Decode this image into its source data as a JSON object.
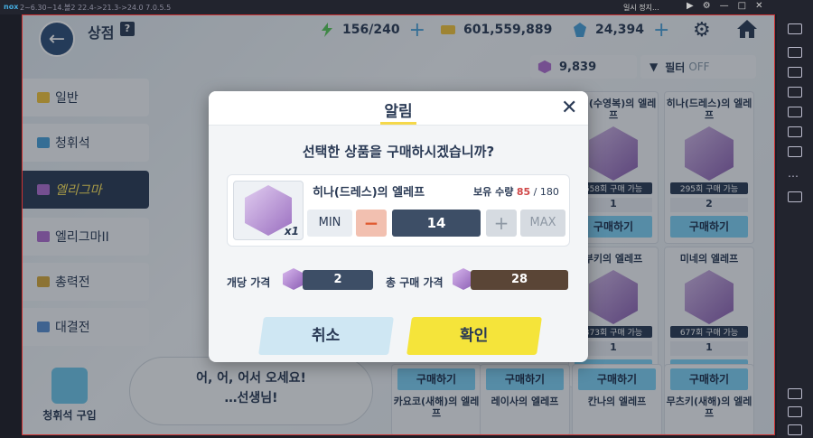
{
  "emulator": {
    "logo": "nox",
    "version_text": "2~6.30~14.볼2 22.4->21.3->24.0 7.0.5.5",
    "pause_text": "일시 정지..."
  },
  "header": {
    "title": "상점",
    "help": "?",
    "stamina": "156/240",
    "credits": "601,559,889",
    "gems": "24,394"
  },
  "sidebar": {
    "items": [
      {
        "label": "일반",
        "icon": "credit-icon",
        "color": "#f2c33a"
      },
      {
        "label": "청휘석",
        "icon": "gem-icon",
        "color": "#4aa0d8"
      },
      {
        "label": "엘리그마",
        "icon": "eligma-icon",
        "color": "#b06fd0",
        "active": true
      },
      {
        "label": "엘리그마II",
        "icon": "eligma-icon",
        "color": "#b06fd0"
      },
      {
        "label": "총력전",
        "icon": "raid-coin-icon",
        "color": "#d6a93c"
      },
      {
        "label": "대결전",
        "icon": "battle-coin-icon",
        "color": "#5a8fd0"
      }
    ]
  },
  "eligma_count": "9,839",
  "filter": {
    "label": "필터",
    "state": "OFF"
  },
  "cards": [
    {
      "title": "이미(수영복)의 엘레프",
      "avail": "658회 구매 가능",
      "qty": "1",
      "buy": "구매하기"
    },
    {
      "title": "히나(드레스)의 엘레프",
      "avail": "295회 구매 가능",
      "qty": "2",
      "buy": "구매하기"
    },
    {
      "title": "부키의 엘레프",
      "avail": "373회 구매 가능",
      "qty": "1",
      "buy": "구매하기"
    },
    {
      "title": "미네의 엘레프",
      "avail": "677회 구매 가능",
      "qty": "1",
      "buy": "구매하기"
    },
    {
      "title": "카요코(새해)의 엘레프",
      "buy": "구매하기"
    },
    {
      "title": "레이사의 엘레프",
      "buy": "구매하기"
    },
    {
      "title": "칸나의 엘레프",
      "buy": "구매하기"
    },
    {
      "title": "무츠키(새해)의 엘레프",
      "buy": "구매하기"
    }
  ],
  "speech": {
    "line1": "어, 어, 어서 오세요!",
    "line2": "…선생님!"
  },
  "gem_purchase": "청휘석 구입",
  "modal": {
    "title": "알림",
    "question": "선택한 상품을 구매하시겠습니까?",
    "item_name": "히나(드레스)의 엘레프",
    "item_count": "x1",
    "owned_label": "보유 수량",
    "owned_have": "85",
    "owned_max": "/ 180",
    "min_label": "MIN",
    "max_label": "MAX",
    "quantity": "14",
    "unit_price_label": "개당 가격",
    "unit_price": "2",
    "total_price_label": "총 구매 가격",
    "total_price": "28",
    "cancel": "취소",
    "confirm": "확인"
  }
}
